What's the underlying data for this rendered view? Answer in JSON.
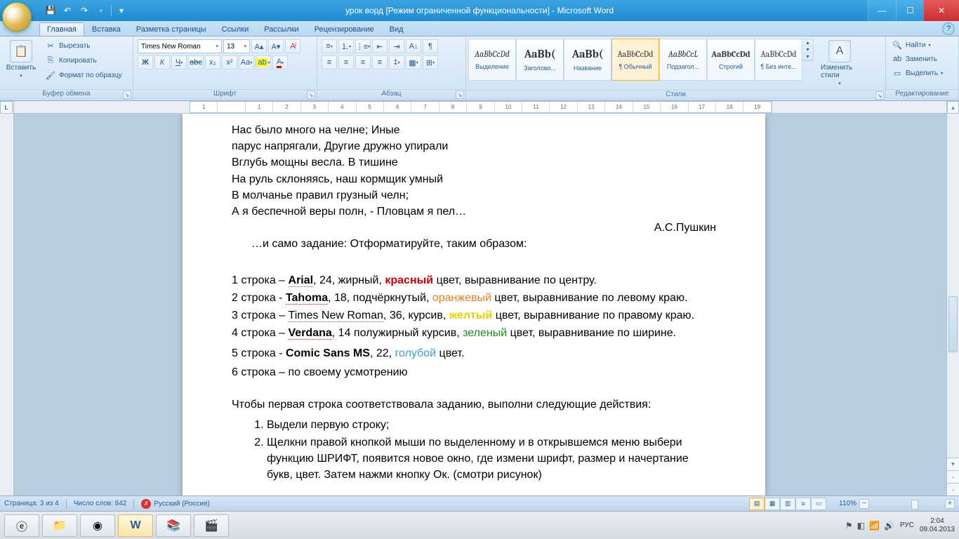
{
  "title": "урок ворд [Режим ограниченной функциональности] - Microsoft Word",
  "tabs": [
    "Главная",
    "Вставка",
    "Разметка страницы",
    "Ссылки",
    "Рассылки",
    "Рецензирование",
    "Вид"
  ],
  "clipboard": {
    "label": "Буфер обмена",
    "paste": "Вставить",
    "cut": "Вырезать",
    "copy": "Копировать",
    "format": "Формат по образцу"
  },
  "font": {
    "label": "Шрифт",
    "name": "Times New Roman",
    "size": "13"
  },
  "para": {
    "label": "Абзац"
  },
  "styles": {
    "label": "Стили",
    "items": [
      {
        "prev": "AaBbCcDd",
        "name": "Выделение"
      },
      {
        "prev": "AaBb(",
        "name": "Заголово..."
      },
      {
        "prev": "AaBb(",
        "name": "Название"
      },
      {
        "prev": "AaBbCcDd",
        "name": "¶ Обычный"
      },
      {
        "prev": "AaBbCcL",
        "name": "Подзагол..."
      },
      {
        "prev": "AaBbCcDd",
        "name": "Строгий"
      },
      {
        "prev": "AaBbCcDd",
        "name": "¶ Без инте..."
      }
    ],
    "change": "Изменить стили"
  },
  "editing": {
    "label": "Редактирование",
    "find": "Найти",
    "replace": "Заменить",
    "select": "Выделить"
  },
  "ruler_marks": [
    "1",
    "",
    "1",
    "2",
    "3",
    "4",
    "5",
    "6",
    "7",
    "8",
    "9",
    "10",
    "11",
    "12",
    "13",
    "14",
    "15",
    "16",
    "17",
    "18",
    "19"
  ],
  "doc": {
    "poem": [
      "Нас было много на челне; Иные",
      "парус напрягали, Другие дружно упирали",
      "Вглубь мощны весла. В тишине",
      "На руль склоняясь, наш кормщик умный",
      "В молчанье правил грузный челн;",
      "А я беспечной веры полн,  - Пловцам я пел…"
    ],
    "signature": "А.С.Пушкин",
    "task_intro": "…и само задание: Отформатируйте, таким образом:",
    "lines": {
      "l1a": "1 строка – ",
      "l1b": "Arial",
      "l1c": ", 24, жирный, ",
      "l1d": "красный",
      "l1e": " цвет,  выравнивание по центру.",
      "l2a": "2 строка - ",
      "l2b": "Tahoma",
      "l2c": ", 18, подчёркнутый, ",
      "l2d": "оранжевый",
      "l2e": " цвет,  выравнивание по левому краю.",
      "l3a": "3 строка – ",
      "l3b": "Times New Roman",
      "l3c": ", 36, курсив, ",
      "l3d": "желтый",
      "l3e": " цвет,  выравнивание по правому краю.",
      "l4a": "4 строка – ",
      "l4b": "Verdana",
      "l4c": ", 14 полужирный курсив, ",
      "l4d": "зеленый",
      "l4e": " цвет,  выравнивание по ширине.",
      "l5a": "5 строка - ",
      "l5b": "Comic Sans MS",
      "l5c": ", 22,  ",
      "l5d": "голубой",
      "l5e": " цвет.",
      "l6": "6 строка – по своему усмотрению"
    },
    "instr_head": "Чтобы первая строка соответствовала заданию, выполни следующие действия:",
    "instr": [
      "Выдели первую строку;",
      "Щелкни правой кнопкой мыши по выделенному и в открывшемся меню выбери функцию ШРИФТ, появится новое окно, где измени шрифт, размер и начертание букв, цвет. Затем нажми кнопку Ок. (смотри рисунок)"
    ]
  },
  "status": {
    "page": "Страница: 3 из 4",
    "words": "Число слов: 842",
    "lang": "Русский (Россия)",
    "zoom": "110%"
  },
  "tray": {
    "lang": "РУС",
    "time": "2:04",
    "date": "09.04.2013"
  }
}
